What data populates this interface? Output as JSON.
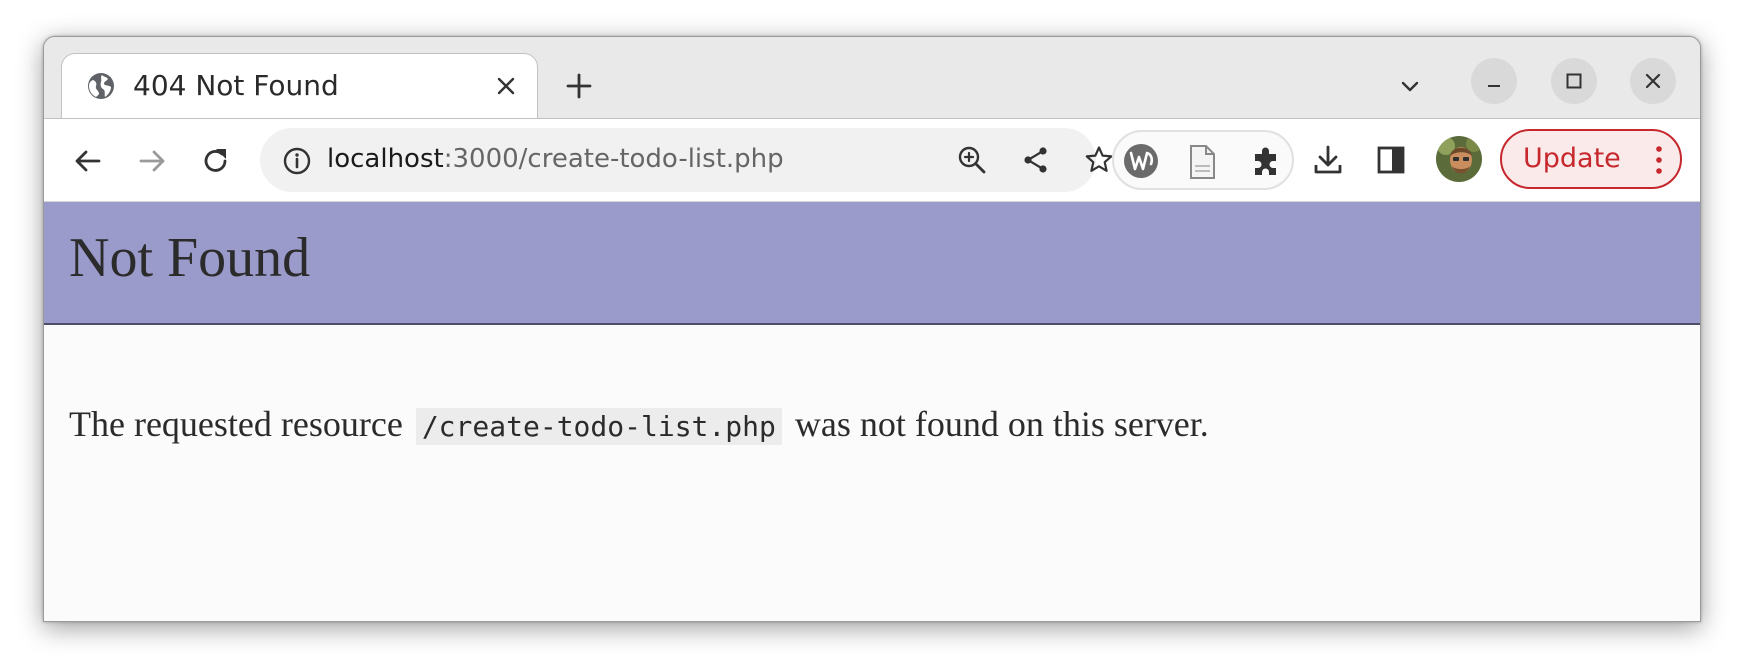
{
  "browser": {
    "tab": {
      "title": "404 Not Found",
      "favicon": "globe-icon"
    },
    "new_tab_icon": "plus-icon",
    "tab_search_icon": "chevron-down-icon",
    "window_controls": [
      "minimize-icon",
      "maximize-icon",
      "close-icon"
    ],
    "toolbar": {
      "back_icon": "arrow-left-icon",
      "forward_icon": "arrow-right-icon",
      "reload_icon": "reload-icon",
      "site_info_icon": "info-icon",
      "url_host": "localhost",
      "url_rest": ":3000/create-todo-list.php",
      "zoom_icon": "zoom-in-icon",
      "share_icon": "share-icon",
      "bookmark_icon": "star-icon",
      "extensions": [
        "extension-w-icon",
        "extension-page-icon",
        "puzzle-icon"
      ],
      "download_icon": "download-icon",
      "side_panel_icon": "side-panel-icon",
      "update_label": "Update",
      "menu_icon": "kebab-menu-icon"
    }
  },
  "page": {
    "heading": "Not Found",
    "message_before": "The requested resource",
    "resource_path": "/create-todo-list.php",
    "message_after": "was not found on this server."
  },
  "colors": {
    "banner": "#9a9bcb",
    "update_accent": "#c6282d",
    "tabstrip": "#e9e9e9"
  }
}
